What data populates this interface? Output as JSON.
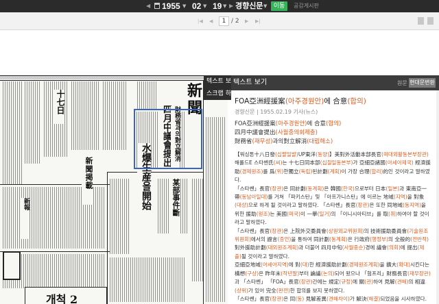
{
  "topbar": {
    "prev_arrow": "◀",
    "next_arrow": "▶",
    "year": "1955",
    "month": "02",
    "day": "19",
    "source": "경향신문",
    "go_label": "이동",
    "board_label": "공감게시판"
  },
  "pager": {
    "current_page": "1",
    "total": "/ 2"
  },
  "paper": {
    "masthead": "新聞",
    "headline_1": "四月中議會提出",
    "headline_1_sub": "財務省과의對立解消",
    "headline_2": "水爆生産을開始",
    "headline_3": "某部事件斷",
    "headline_4": "新報",
    "ad_text": "개척 2"
  },
  "context_menu": {
    "items": [
      "텍스트 보기",
      "스크랩 하기"
    ]
  },
  "panel": {
    "title": "텍스트 보기",
    "original_label": "원문",
    "modern_label": "현대문변환",
    "article_title_pre": "FOA亞洲經援案",
    "article_title_p1": "(아주경원안)",
    "article_title_mid": "에 合意",
    "article_title_p2": "(합의)",
    "meta": "경향신문 | 1955.02.19 기사(뉴스)",
    "headlines": [
      {
        "pre": "FOA亞洲經援案",
        "paren": "(아주경원안)",
        "mid": "에 合意",
        "paren2": "(합의)"
      },
      {
        "pre": "四月中議會提出",
        "paren": "(사월중의회제출)",
        "mid": "",
        "paren2": ""
      },
      {
        "pre": "財務省",
        "paren": "(재무성)",
        "mid": "과의對立解消",
        "paren2": "(대립해소)"
      }
    ],
    "body": [
      "【워싱톤十八日發(십팔일발)UP東洋(동양)】美對外活動本部長官(미대외활동본부장관) 해롤드E 스타쎈氏(씨)는 十七日同本部(십칠일동본부)가 亞細亞諸國(아세아제국) 經濟援助(경제원조)를 爲(위)한獨立(독립)된計劃(계획)이 가장 合理(합리)的인 것이라고 말하였다.",
      "「스타쎈」長官(장관)은 同計劃(동계획)은 韓國(한국)으로부터 日本(일본)과 東南亞一帶(동남아일대)를 거쳐 「파키스탄」및 「아프가니스탄」에 이르는 地域(지역)을 對象(대상)으로 하게 될 것이라고 말하였다. 「스타쎈」長官(장관)은 또한 同地域(동지역)을 위한 援助(원조)는 美國(미국)이 一擧(일거)의 「이니시아티브」를 取(취)하여야 할 것이라고 말하였다.",
      "「스타쎈」長官(장관)은 上院外交委員會(상원외교위원회)의 技術援助委員會(기술원조위원회)에서의 證言(증언)을 통하여 同計劃(동계획)은 行政府(행정부)의 全般的(전반적) 對外援助計劃(대외원조계획)과 더불어 四月中旬(사월중순)경에 議會(의회)에 提出(제출)될 것이라고 말하였다.",
      "亞細亞地域(아세아지역)에 對(대)한 經濟援助計劃(경제원조계획)을 擴大(확대)시킨다는 構想(구상)은 昨年末(작년말)부터 論議(논의)되어 왔으나 「험프리」財務長官(재무장관)과 「스타쎈」 「FOA」長官(장관)간에는 規定(규정)에 關(관)하여 見解(견해)의 相違(상위)가 있어 完全(완전)한 합의를 보지 못하였다.",
      "「스타쎈」長官(장관)은 同(동) 見解差異(견해차이)가 解決(해결)되었음을 시사하였다."
    ]
  }
}
